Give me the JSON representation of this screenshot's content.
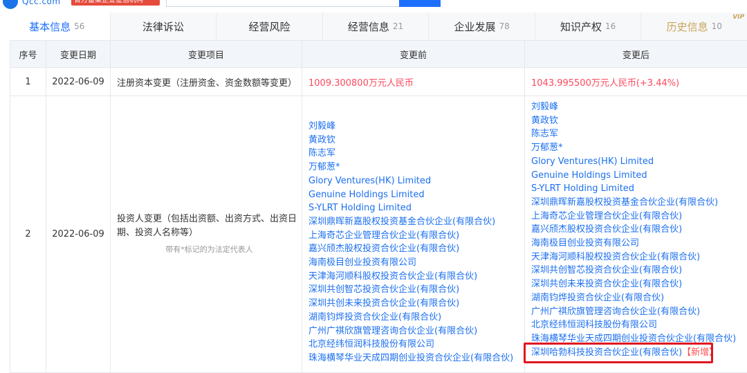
{
  "header": {
    "logo_text": "Qcc.com",
    "badge_text": "官方备案企业征信机构",
    "search_value": "",
    "colors": {
      "brand": "#1e6fff",
      "badge": "#e54a3c"
    }
  },
  "tabs": [
    {
      "label": "基本信息",
      "count": "56",
      "active": true
    },
    {
      "label": "法律诉讼",
      "count": ""
    },
    {
      "label": "经营风险",
      "count": ""
    },
    {
      "label": "经营信息",
      "count": "21"
    },
    {
      "label": "企业发展",
      "count": "78"
    },
    {
      "label": "知识产权",
      "count": "16"
    },
    {
      "label": "历史信息",
      "count": "10",
      "vip": "VIP"
    }
  ],
  "table": {
    "headers": [
      "序号",
      "变更日期",
      "变更项目",
      "变更前",
      "变更后"
    ],
    "rows": [
      {
        "index": "1",
        "date": "2022-06-09",
        "item": "注册资本变更（注册资金、资金数额等变更）",
        "before": "1009.300800万元人民币",
        "after": "1043.995500万元人民币(+3.44%)"
      },
      {
        "index": "2",
        "date": "2022-06-09",
        "item": "投资人变更（包括出资额、出资方式、出资日期、投资人名称等）",
        "note": "带有*标记的为法定代表人",
        "before": [
          "刘毅峰",
          "黄政钦",
          "陈志军",
          "万郁葱*",
          "Glory Ventures(HK) Limited",
          "Genuine Holdings Limited",
          "S-YLRT Holding Limited",
          "深圳鼎晖新嘉股权投资基金合伙企业(有限合伙)",
          "上海奇芯企业管理合伙企业(有限合伙)",
          "嘉兴颀杰股权投资合伙企业(有限合伙)",
          "海南极目创业投资有限公司",
          "天津海河顺科股权投资合伙企业(有限合伙)",
          "深圳共创智芯投资合伙企业(有限合伙)",
          "深圳共创未来投资合伙企业(有限合伙)",
          "湖南钧烨投资合伙企业(有限合伙)",
          "广州广祺欣旗管理咨询合伙企业(有限合伙)",
          "北京经纬恒润科技股份有限公司",
          "珠海横琴华业天成四期创业投资合伙企业(有限合伙)"
        ],
        "after": [
          "刘毅峰",
          "黄政钦",
          "陈志军",
          "万郁葱*",
          "Glory Ventures(HK) Limited",
          "Genuine Holdings Limited",
          "S-YLRT Holding Limited",
          "深圳鼎晖新嘉股权投资基金合伙企业(有限合伙)",
          "上海奇芯企业管理合伙企业(有限合伙)",
          "嘉兴颀杰股权投资合伙企业(有限合伙)",
          "海南极目创业投资有限公司",
          "天津海河顺科股权投资合伙企业(有限合伙)",
          "深圳共创智芯投资合伙企业(有限合伙)",
          "深圳共创未来投资合伙企业(有限合伙)",
          "湖南钧烨投资合伙企业(有限合伙)",
          "广州广祺欣旗管理咨询合伙企业(有限合伙)",
          "北京经纬恒润科技股份有限公司",
          "珠海横琴华业天成四期创业投资合伙企业(有限合伙)"
        ],
        "after_new": {
          "name": "深圳哈勃科技投资合伙企业(有限合伙)",
          "tag": "【新增】"
        }
      }
    ]
  }
}
